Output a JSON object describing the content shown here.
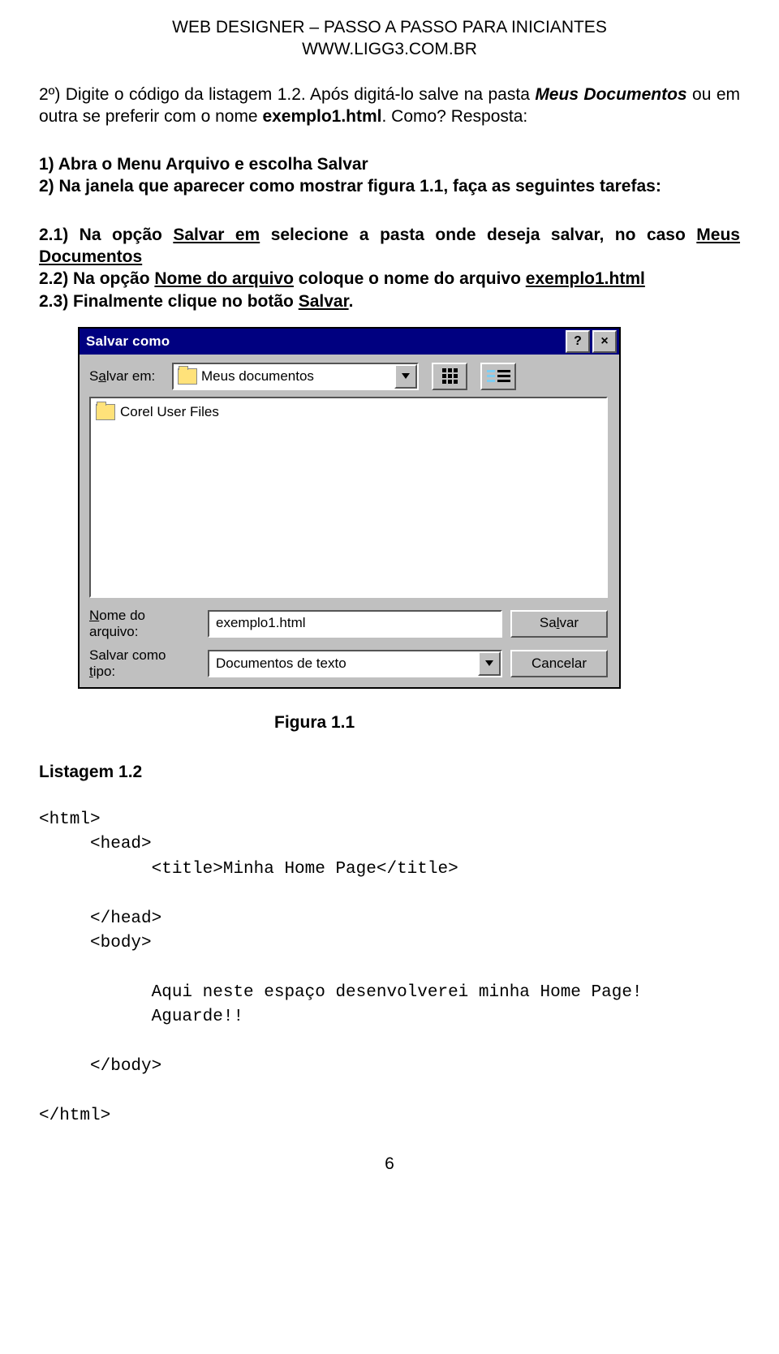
{
  "header": {
    "line1": "WEB DESIGNER – PASSO A PASSO PARA INICIANTES",
    "line2": "WWW.LIGG3.COM.BR"
  },
  "intro": {
    "prefix": "2º) Digite o código da listagem 1.2. Após digitá-lo salve na pasta ",
    "italic": "Meus Documentos",
    "mid": " ou em outra se preferir com o nome ",
    "filename": "exemplo1.html",
    "after": ". Como? Resposta:"
  },
  "steps1": {
    "l1": "1) Abra o Menu Arquivo e escolha Salvar",
    "l2": "2) Na janela que aparecer como mostrar figura 1.1, faça as seguintes tarefas:"
  },
  "steps2": {
    "l1a": "2.1) Na opção ",
    "l1_u": "Salvar em",
    "l1b": " selecione a pasta onde deseja salvar, no caso ",
    "l1c": "Meus Documentos",
    "l2a": "2.2) Na opção ",
    "l2_u": "Nome do arquivo",
    "l2b": " coloque o nome do arquivo ",
    "l2c": "exemplo1.html",
    "l3a": "2.3) Finalmente clique  no botão ",
    "l3_u": "Salvar",
    "l3b": "."
  },
  "dialog": {
    "title": "Salvar como",
    "help_char": "?",
    "close_char": "×",
    "save_in_label": {
      "pre": "S",
      "u": "a",
      "post": "lvar em:"
    },
    "save_in_value": "Meus documentos",
    "file_list_item": "Corel User Files",
    "name_label": {
      "line1_pre": "",
      "line1_u": "N",
      "line1_post": "ome do",
      "line2": "arquivo:"
    },
    "name_value": "exemplo1.html",
    "type_label": {
      "line1": "Salvar como",
      "line2_u": "t",
      "line2_post": "ipo:"
    },
    "type_value": "Documentos de texto",
    "btn_save": {
      "pre": "Sa",
      "u": "l",
      "post": "var"
    },
    "btn_cancel": "Cancelar"
  },
  "figure_caption": "Figura 1.1",
  "listing_title": "Listagem 1.2",
  "code": "<html>\n     <head>\n           <title>Minha Home Page</title>\n\n     </head>\n     <body>\n\n           Aqui neste espaço desenvolverei minha Home Page!\n           Aguarde!!\n\n     </body>\n\n</html>",
  "page_number": "6"
}
